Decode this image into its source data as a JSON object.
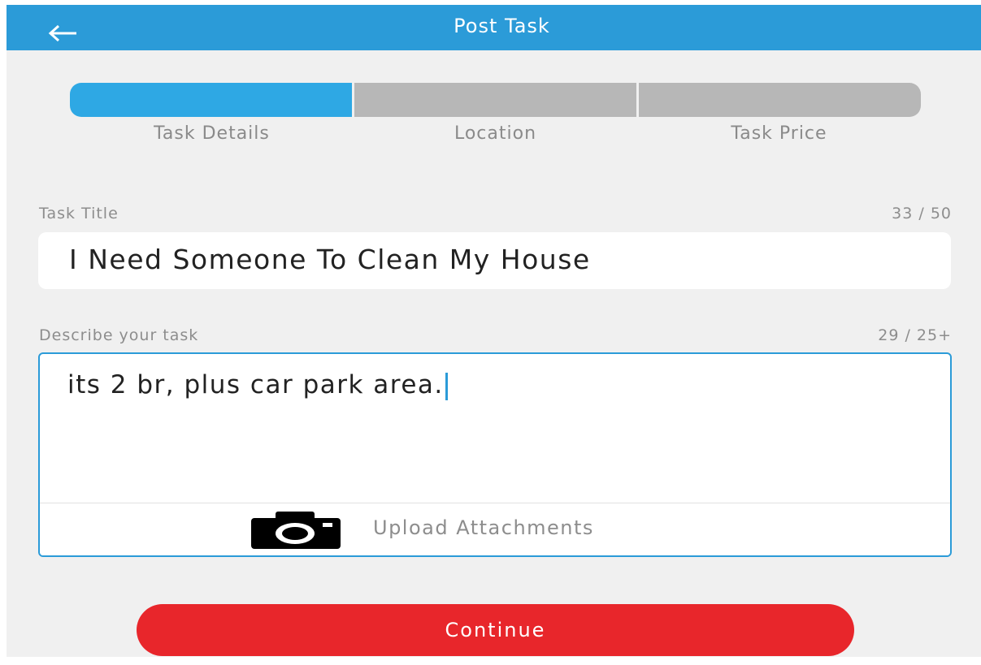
{
  "header": {
    "title": "Post Task"
  },
  "progress": {
    "current_step": 1,
    "steps": [
      {
        "label": "Task Details"
      },
      {
        "label": "Location"
      },
      {
        "label": "Task Price"
      }
    ]
  },
  "form": {
    "title_label": "Task Title",
    "title_counter": "33 / 50",
    "title_value": "I Need Someone To Clean My House",
    "description_label": "Describe your task",
    "description_counter": "29 / 25+",
    "description_value": "its 2 br, plus car park area.",
    "upload_label": "Upload Attachments"
  },
  "actions": {
    "continue_label": "Continue"
  },
  "colors": {
    "header": "#2b9bd8",
    "progress_active": "#2ea8e4",
    "progress_inactive": "#b7b7b7",
    "continue": "#e8262b",
    "background": "#f0f0f0"
  },
  "icons": {
    "back": "arrow-left-icon",
    "camera": "camera-icon"
  }
}
